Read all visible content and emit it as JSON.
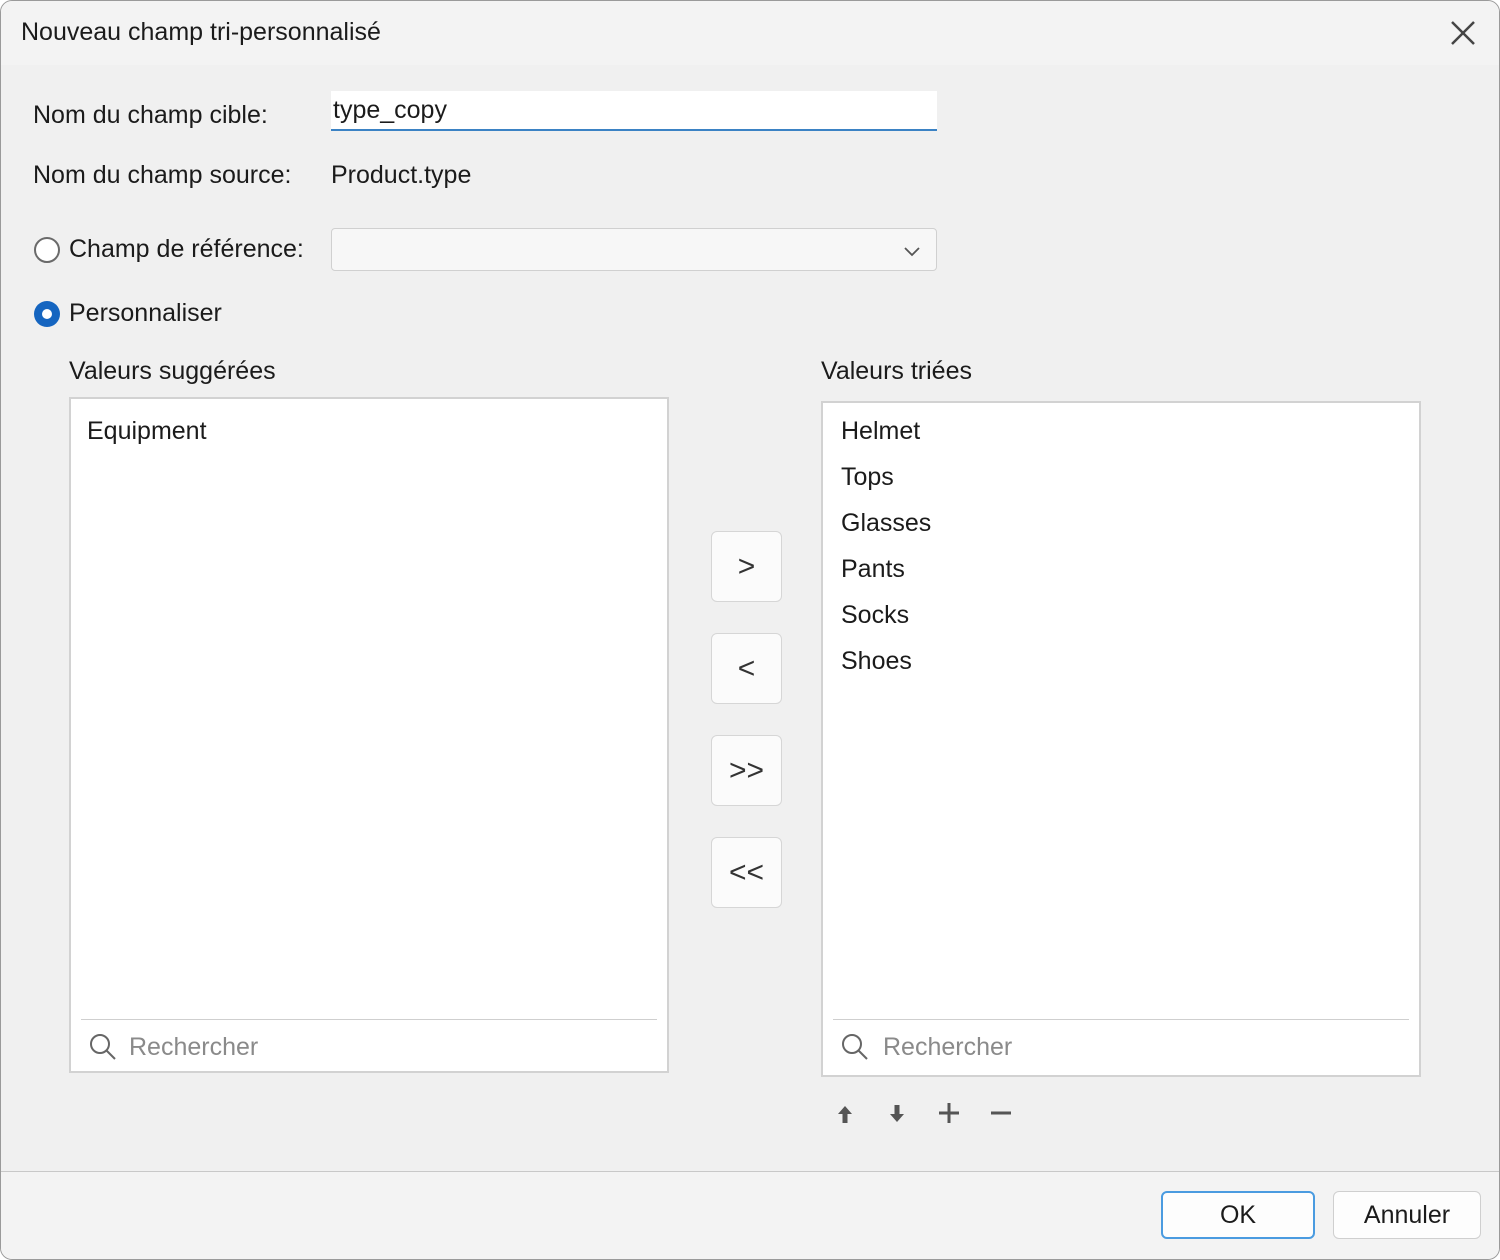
{
  "window": {
    "title": "Nouveau champ tri-personnalisé"
  },
  "form": {
    "target_label": "Nom du champ cible:",
    "target_value": "type_copy",
    "source_label": "Nom du champ source:",
    "source_value": "Product.type",
    "reference_label": "Champ de référence:",
    "reference_value": "",
    "custom_label": "Personnaliser",
    "selected_mode": "custom"
  },
  "suggested": {
    "title": "Valeurs suggérées",
    "items": [
      "Equipment"
    ],
    "search_placeholder": "Rechercher"
  },
  "sorted": {
    "title": "Valeurs triées",
    "items": [
      "Helmet",
      "Tops",
      "Glasses",
      "Pants",
      "Socks",
      "Shoes"
    ],
    "search_placeholder": "Rechercher"
  },
  "transfer_buttons": {
    "move_right": ">",
    "move_left": "<",
    "move_all_right": ">>",
    "move_all_left": "<<"
  },
  "toolbar_icons": [
    "arrow-up-icon",
    "arrow-down-icon",
    "plus-icon",
    "minus-icon"
  ],
  "footer": {
    "ok_label": "OK",
    "cancel_label": "Annuler"
  },
  "colors": {
    "accent": "#1565c0",
    "focus_border": "#4a9be0"
  }
}
